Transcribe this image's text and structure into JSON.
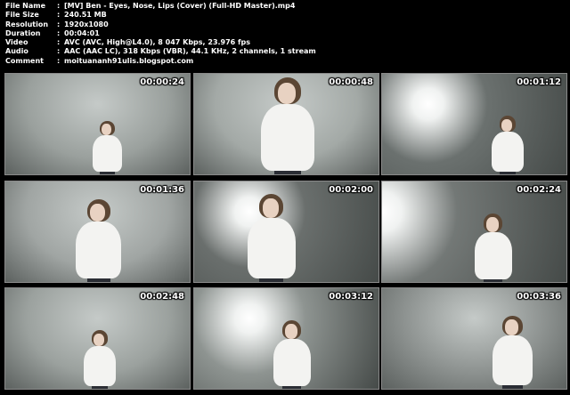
{
  "info": [
    {
      "label": "File Name",
      "value": "[MV] Ben - Eyes, Nose, Lips (Cover) (Full-HD Master).mp4"
    },
    {
      "label": "File Size",
      "value": "240.51 MB"
    },
    {
      "label": "Resolution",
      "value": "1920x1080"
    },
    {
      "label": "Duration",
      "value": "00:04:01"
    },
    {
      "label": "Video",
      "value": "AVC (AVC, High@L4.0), 8 047 Kbps, 23.976 fps"
    },
    {
      "label": "Audio",
      "value": "AAC (AAC LC), 318 Kbps (VBR), 44.1 KHz, 2 channels, 1 stream"
    },
    {
      "label": "Comment",
      "value": "moituananh91ulis.blogspot.com"
    }
  ],
  "separator": ":",
  "thumbnails": [
    {
      "time": "00:00:24",
      "bg": "#9aa09d",
      "glow": false
    },
    {
      "time": "00:00:48",
      "bg": "#a3a9a6",
      "glow": false
    },
    {
      "time": "00:01:12",
      "bg": "#6b716f",
      "glow": true
    },
    {
      "time": "00:01:36",
      "bg": "#a0a5a3",
      "glow": false
    },
    {
      "time": "00:02:00",
      "bg": "#6a6f6d",
      "glow": true
    },
    {
      "time": "00:02:24",
      "bg": "#737876",
      "glow": true
    },
    {
      "time": "00:02:48",
      "bg": "#9ba19e",
      "glow": false
    },
    {
      "time": "00:03:12",
      "bg": "#8e9491",
      "glow": true
    },
    {
      "time": "00:03:36",
      "bg": "#8c918f",
      "glow": false
    }
  ]
}
